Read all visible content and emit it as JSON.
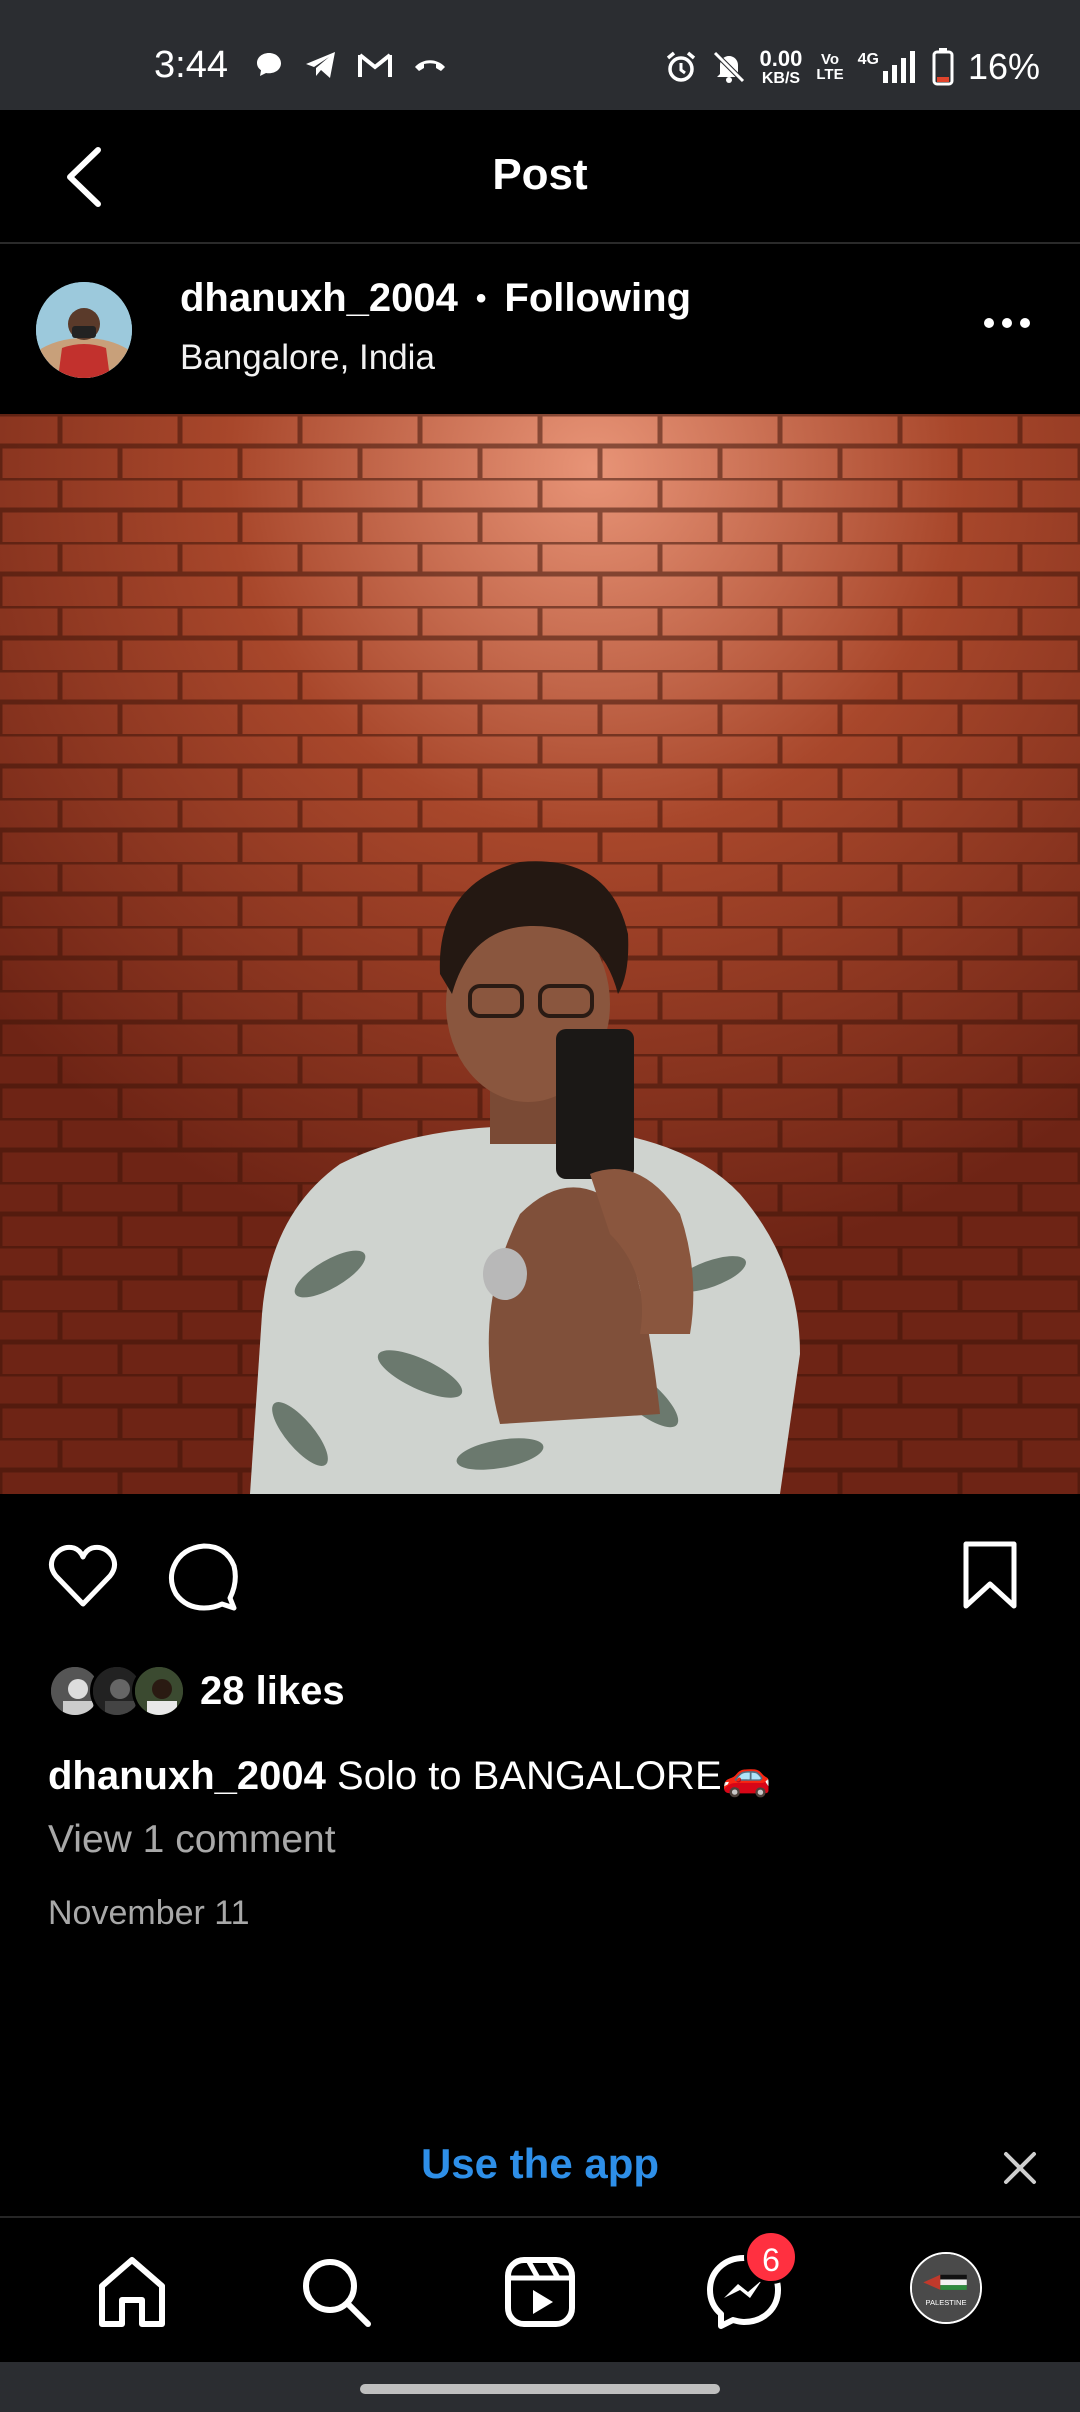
{
  "status_bar": {
    "time": "3:44",
    "speed_value": "0.00",
    "speed_unit": "KB/S",
    "volte_top": "Vo",
    "volte_bottom": "LTE",
    "network": "4G",
    "battery": "16%"
  },
  "header": {
    "title": "Post"
  },
  "post": {
    "username": "dhanuxh_2004",
    "separator": "•",
    "follow_status": "Following",
    "location": "Bangalore, India",
    "likes": "28 likes",
    "caption_user": "dhanuxh_2004",
    "caption_text": "Solo to BANGALORE🚗",
    "view_comments": "View 1 comment",
    "date": "November 11"
  },
  "banner": {
    "label": "Use the app"
  },
  "bottom_nav": {
    "messages_badge": "6",
    "profile_text": "PALESTINE"
  },
  "colors": {
    "accent_blue": "#2e8fe8",
    "badge_red": "#ff3040",
    "status_bar_bg": "#2b2d31"
  }
}
